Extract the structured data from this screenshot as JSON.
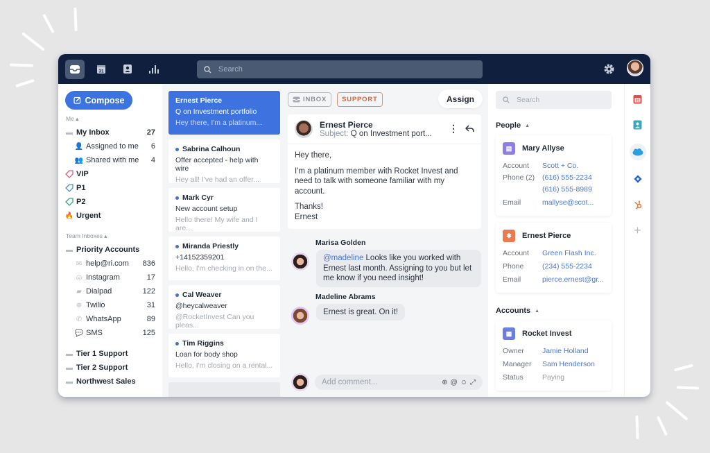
{
  "topbar": {
    "nav": [
      {
        "name": "inbox-icon",
        "active": true
      },
      {
        "name": "calendar-icon",
        "label": "31"
      },
      {
        "name": "contacts-icon"
      },
      {
        "name": "analytics-icon"
      }
    ],
    "search_placeholder": "Search"
  },
  "sidebar": {
    "compose_label": "Compose",
    "me_label": "Me",
    "my_inbox": {
      "label": "My Inbox",
      "count": "27"
    },
    "assigned": {
      "label": "Assigned to me",
      "count": "6"
    },
    "shared": {
      "label": "Shared with me",
      "count": "4"
    },
    "tags": [
      {
        "label": "VIP",
        "color": "#e05a7d"
      },
      {
        "label": "P1",
        "color": "#4a8fd8"
      },
      {
        "label": "P2",
        "color": "#3aa37a"
      }
    ],
    "urgent_label": "Urgent",
    "team_label": "Team Inboxes",
    "priority_accounts": "Priority Accounts",
    "channels": [
      {
        "label": "help@ri.com",
        "count": "836"
      },
      {
        "label": "Instagram",
        "count": "17"
      },
      {
        "label": "Dialpad",
        "count": "122"
      },
      {
        "label": "Twilio",
        "count": "31"
      },
      {
        "label": "WhatsApp",
        "count": "89"
      },
      {
        "label": "SMS",
        "count": "125"
      }
    ],
    "teams": [
      "Tier 1 Support",
      "Tier 2 Support",
      "Northwest Sales"
    ]
  },
  "conversations": [
    {
      "name": "Ernest Pierce",
      "subject": "Q on Investment portfolio",
      "preview": "Hey there, I'm a platinum...",
      "selected": true
    },
    {
      "name": "Sabrina Calhoun",
      "subject": "Offer accepted - help with wire",
      "preview": "Hey all! I've had an offer..."
    },
    {
      "name": "Mark Cyr",
      "subject": "New account setup",
      "preview": "Hello there! My wife and I are..."
    },
    {
      "name": "Miranda Priestly",
      "subject": "+14152359201",
      "preview": "Hello, I'm checking in on the..."
    },
    {
      "name": "Cal Weaver",
      "subject": "@heycalweaver",
      "preview": "@RocketInvest Can you pleas..."
    },
    {
      "name": "Tim Riggins",
      "subject": "Loan for body shop",
      "preview": "Hello, I'm closing on a rental..."
    }
  ],
  "thread": {
    "tags": [
      "INBOX",
      "SUPPORT"
    ],
    "assign_label": "Assign",
    "message": {
      "sender": "Ernest Pierce",
      "subject_label": "Subject:",
      "subject": "Q on Investment port...",
      "body": [
        "Hey there,",
        "I'm a platinum member with Rocket Invest and need to talk with someone familiar with my account.",
        "Thanks!",
        "Ernest"
      ]
    },
    "comments": [
      {
        "author": "Marisa Golden",
        "mention": "@madeline",
        "text": " Looks like you worked with Ernest last month. Assigning to you but let me know if you need insight!"
      },
      {
        "author": "Madeline Abrams",
        "text": "Ernest is great. On it!"
      }
    ],
    "add_comment_placeholder": "Add comment..."
  },
  "contacts": {
    "search_placeholder": "Search",
    "people_label": "People",
    "people": [
      {
        "name": "Mary Allyse",
        "badge_color": "#8e7fe0",
        "rows": [
          {
            "k": "Account",
            "v": "Scott + Co."
          },
          {
            "k": "Phone (2)",
            "v": "(616) 555-2234"
          },
          {
            "k": "",
            "v": "(616) 555-8989"
          },
          {
            "k": "Email",
            "v": "mallyse@scot..."
          }
        ]
      },
      {
        "name": "Ernest Pierce",
        "badge_color": "#ec7a4f",
        "rows": [
          {
            "k": "Account",
            "v": "Green Flash Inc."
          },
          {
            "k": "Phone",
            "v": "(234) 555-2234"
          },
          {
            "k": "Email",
            "v": "pierce.ernest@gr..."
          }
        ]
      }
    ],
    "accounts_label": "Accounts",
    "accounts": [
      {
        "name": "Rocket Invest",
        "badge_color": "#6b7fe0",
        "rows": [
          {
            "k": "Owner",
            "v": "Jamie Holland"
          },
          {
            "k": "Manager",
            "v": "Sam Henderson"
          },
          {
            "k": "Status",
            "v": "Paying"
          }
        ]
      }
    ]
  },
  "integrations": [
    "calendar-app-icon",
    "contacts-app-icon",
    "salesforce-icon",
    "jira-icon",
    "hubspot-icon",
    "add-integration-icon"
  ],
  "colors": {
    "topbar": "#0f1f3d",
    "accent": "#3e72df",
    "support": "#d5653e"
  }
}
